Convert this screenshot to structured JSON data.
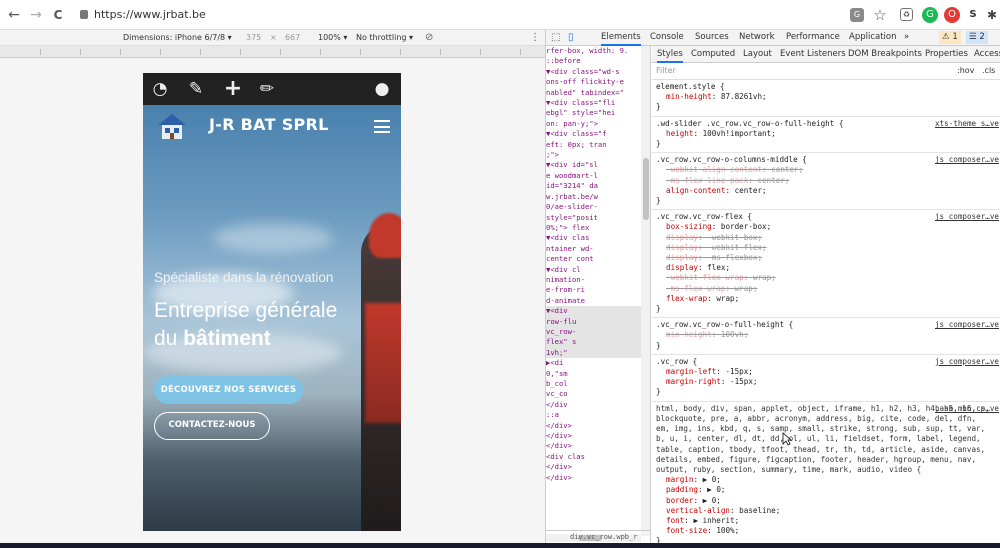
{
  "browser": {
    "url": "https://www.jrbat.be",
    "nav_back": "←",
    "nav_forward": "→",
    "nav_reload": "C",
    "translate_icon": "translate-icon",
    "star_icon": "☆"
  },
  "device_toolbar": {
    "dimensions": "Dimensions: iPhone 6/7/8 ▾",
    "width": "375",
    "times": "×",
    "height": "667",
    "zoom": "100% ▾",
    "throttling": "No throttling ▾"
  },
  "site": {
    "brand": "J-R BAT SPRL",
    "tagline": "Spécialiste dans la rénovation",
    "headline_line1": "Entreprise générale",
    "headline_line2_prefix": "du",
    "headline_line2_bold": "bâtiment",
    "button_services": "DÉCOUVREZ NOS SERVICES",
    "button_contact": "CONTACTEZ-NOUS"
  },
  "devtools": {
    "tabs": [
      "Elements",
      "Console",
      "Sources",
      "Network",
      "Performance",
      "Application",
      "»"
    ],
    "warnings": "1",
    "messages": "2",
    "styles_tabs": [
      "Styles",
      "Computed",
      "Layout",
      "Event Listeners",
      "DOM Breakpoints",
      "Properties",
      "Access"
    ],
    "filter_placeholder": "Filter",
    "hov": ":hov",
    "cls": ".cls",
    "elements_lines": [
      "rfer-box, width: 9.",
      "  ::before",
      "  ▼<div class=\"wd-s",
      "  ons-off flickity-e",
      "  nabled\" tabindex=\"",
      "   ▼<div class=\"fli",
      "   ebgl\" style=\"hei",
      "   on: pan-y;\">",
      "     ▼<div class=\"f",
      "     eft: 0px; tran",
      "     ;\">",
      "       ▼<div id=\"sl",
      "        e woodmart-l",
      "        id=\"3214\" da",
      "        w.jrbat.be/w",
      "        0/ae-slider-",
      "        style=\"posit",
      "        0%;\"> flex",
      "         ▼<div clas",
      "          ntainer wd-",
      "          center cont",
      "          ▼<div cl",
      "            nimation-",
      "            e-from-ri",
      "            d-animate",
      "           ▼<div",
      "            row-flu",
      "            vc_row-",
      "            flex\" s",
      "            1vh;\"",
      "            ▶<di",
      "             0,\"sm",
      "             b_col",
      "             vc_co",
      "             </div",
      "              ::a",
      "             </div>",
      "           </div>",
      "          </div>",
      "          <div clas",
      "          </div>",
      "         </div>"
    ],
    "breadcrumb": "div.vc_row.wpb_r",
    "rules": [
      {
        "selector": "element.style {",
        "source": "",
        "props": [
          {
            "name": "min-height",
            "value": "87.8261vh;",
            "strike": false
          }
        ]
      },
      {
        "selector": ".wd-slider .vc_row.vc_row-o-full-height {",
        "source": "xts-theme_s…ve",
        "props": [
          {
            "name": "height",
            "value": "100vh!important;",
            "strike": false
          }
        ]
      },
      {
        "selector": ".vc_row.vc_row-o-columns-middle {",
        "source": "js_composer…ve",
        "props": [
          {
            "name": "-webkit-align-content",
            "value": "center;",
            "strike": true
          },
          {
            "name": "-ms-flex-line-pack",
            "value": "center;",
            "strike": true
          },
          {
            "name": "align-content",
            "value": "center;",
            "strike": false
          }
        ]
      },
      {
        "selector": ".vc_row.vc_row-flex {",
        "source": "js_composer…ve",
        "props": [
          {
            "name": "box-sizing",
            "value": "border-box;",
            "strike": false
          },
          {
            "name": "display",
            "value": "-webkit-box;",
            "strike": true
          },
          {
            "name": "display",
            "value": "-webkit-flex;",
            "strike": true
          },
          {
            "name": "display",
            "value": "-ms-flexbox;",
            "strike": true
          },
          {
            "name": "display",
            "value": "flex;",
            "strike": false
          },
          {
            "name": "-webkit-flex-wrap",
            "value": "wrap;",
            "strike": true
          },
          {
            "name": "-ms-flex-wrap",
            "value": "wrap;",
            "strike": true
          },
          {
            "name": "flex-wrap",
            "value": "wrap;",
            "strike": false
          }
        ]
      },
      {
        "selector": ".vc_row.vc_row-o-full-height {",
        "source": "js_composer…ve",
        "props": [
          {
            "name": "min-height",
            "value": "100vh;",
            "strike": true
          }
        ]
      },
      {
        "selector": ".vc_row {",
        "source": "js_composer…ve",
        "props": [
          {
            "name": "margin-left",
            "value": "-15px;",
            "strike": false
          },
          {
            "name": "margin-right",
            "value": "-15px;",
            "strike": false
          }
        ]
      }
    ],
    "reset_selector": "html, body, div, span, applet, object, iframe, h1, h2, h3, h4, h5, h6, p, blockquote, pre, a, abbr, acronym, address, big, cite, code, del, dfn, em, img, ins, kbd, q, s, samp, small, strike, strong, sub, sup, tt, var, b, u, i, center, dl, dt, dd, ol, ul, li, fieldset, form, label, legend, table, caption, tbody, tfoot, thead, tr, th, td, article, aside, canvas, details, embed, figure, figcaption, footer, header, hgroup, menu, nav, output, ruby, section, summary, time, mark, audio, video {",
    "reset_source": "base.min.cs…ve",
    "reset_props": [
      {
        "name": "margin",
        "value": "▶ 0;"
      },
      {
        "name": "padding",
        "value": "▶ 0;"
      },
      {
        "name": "border",
        "value": "▶ 0;"
      },
      {
        "name": "vertical-align",
        "value": "baseline;"
      },
      {
        "name": "font",
        "value": "▶ inherit;"
      },
      {
        "name": "font-size",
        "value": "100%;"
      }
    ],
    "close_brace": "}"
  }
}
